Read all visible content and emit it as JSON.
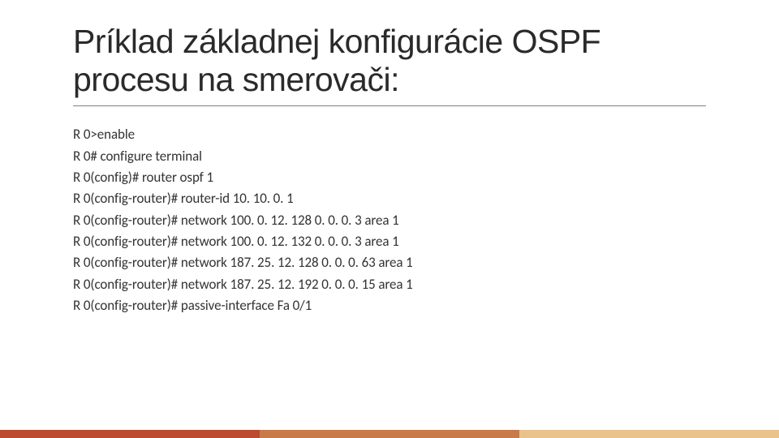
{
  "title": "Príklad základnej konfigurácie OSPF procesu na smerovači:",
  "config": {
    "lines": [
      "R 0>enable",
      "R 0# configure terminal",
      "R 0(config)# router ospf 1",
      "R 0(config-router)# router-id 10. 10. 0. 1",
      "R 0(config-router)# network 100. 0. 12. 128 0. 0. 0. 3 area 1",
      "R 0(config-router)# network 100. 0. 12. 132 0. 0. 0. 3 area 1",
      "R 0(config-router)# network 187. 25. 12. 128 0. 0. 0. 63 area 1",
      "R 0(config-router)# network 187. 25. 12. 192 0. 0. 0. 15 area 1",
      "R 0(config-router)# passive-interface Fa 0/1"
    ]
  },
  "colors": {
    "footer1": "#bc4b31",
    "footer2": "#c87a49",
    "footer3": "#e9c28c"
  }
}
